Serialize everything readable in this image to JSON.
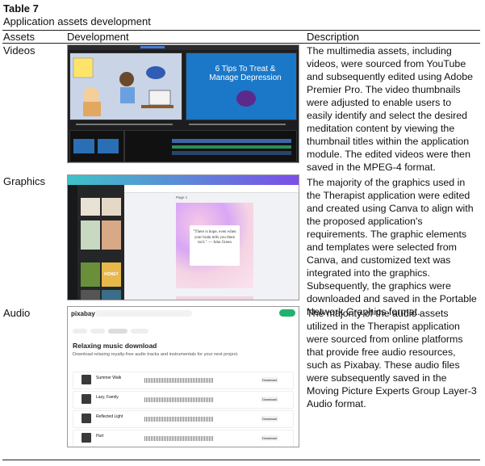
{
  "table": {
    "number": "Table 7",
    "caption": "Application assets development",
    "headers": {
      "assets": "Assets",
      "development": "Development",
      "description": "Description"
    },
    "rows": [
      {
        "asset": "Videos",
        "description": "The multimedia assets, including videos, were sourced from YouTube and subsequently edited using Adobe Premier Pro. The video thumbnails were adjusted to enable users to easily identify and select the desired meditation content by viewing the thumbnail titles within the application module. The edited videos were then saved in the MPEG-4 format.",
        "screenshot": {
          "slide_title": "6 Tips To Treat & Manage Depression",
          "sticky_note": "Cope Depression Techniques Exercise",
          "bubble": "How about you?"
        }
      },
      {
        "asset": "Graphics",
        "description": "The majority of the graphics used in the Therapist application were edited and created using Canva to align with the proposed application's requirements. The graphic elements and templates were selected from Canva, and customized text was integrated into the graphics. Subsequently, the graphics were downloaded and saved in the Portable Network Graphics format.",
        "screenshot": {
          "quote": "\"There is hope, even when your brain tells you there isn't.\" — John Green",
          "poster_label": "HONEY",
          "page_label": "Page 1"
        }
      },
      {
        "asset": "Audio",
        "description": "The majority of the audio assets utilized in the Therapist application were sourced from online platforms that provide free audio resources, such as Pixabay. These audio files were subsequently saved in the Moving Picture Experts Group Layer-3 Audio format.",
        "screenshot": {
          "logo": "pixabay",
          "heading": "Relaxing music download",
          "subheading": "Download relaxing royalty-free audio tracks and instrumentals for your next project.",
          "tracks": [
            "Summer Walk",
            "Lazy, Family",
            "Reflected Light",
            "Hurt"
          ],
          "download_label": "Download"
        }
      }
    ]
  }
}
